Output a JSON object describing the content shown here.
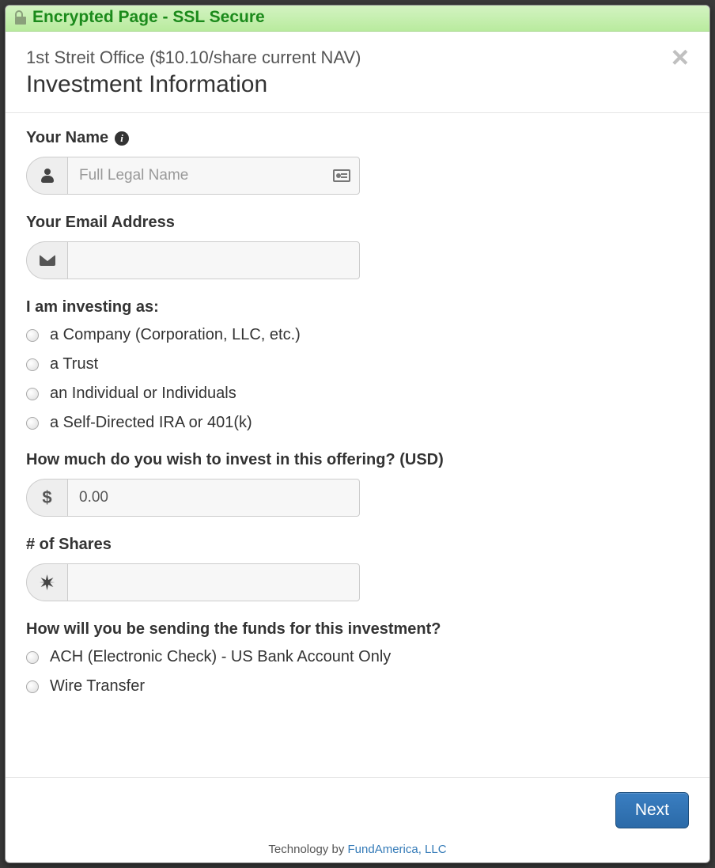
{
  "ssl_banner": "Encrypted Page - SSL Secure",
  "header": {
    "subtitle": "1st Streit Office ($10.10/share current NAV)",
    "title": "Investment Information"
  },
  "form": {
    "name": {
      "label": "Your Name",
      "placeholder": "Full Legal Name",
      "value": ""
    },
    "email": {
      "label": "Your Email Address",
      "value": ""
    },
    "investing_as": {
      "label": "I am investing as:",
      "options": [
        "a Company (Corporation, LLC, etc.)",
        "a Trust",
        "an Individual or Individuals",
        "a Self-Directed IRA or 401(k)"
      ]
    },
    "amount": {
      "label": "How much do you wish to invest in this offering? (USD)",
      "currency_symbol": "$",
      "value": "0.00"
    },
    "shares": {
      "label": "# of Shares",
      "value": ""
    },
    "funding": {
      "label": "How will you be sending the funds for this investment?",
      "options": [
        "ACH (Electronic Check) - US Bank Account Only",
        "Wire Transfer"
      ]
    }
  },
  "footer": {
    "next_label": "Next",
    "tech_prefix": "Technology by ",
    "tech_link": "FundAmerica, LLC"
  }
}
